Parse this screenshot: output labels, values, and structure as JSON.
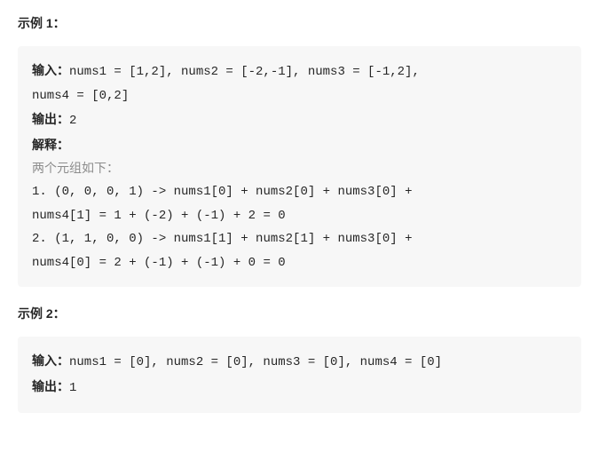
{
  "example1": {
    "heading": "示例 1：",
    "input_label": "输入：",
    "input_line1": "nums1 = [1,2], nums2 = [-2,-1], nums3 = [-1,2],",
    "input_line2": "nums4 = [0,2]",
    "output_label": "输出：",
    "output_value": "2",
    "explain_label": "解释：",
    "tuples_note": "两个元组如下：",
    "calc1_line1": "1. (0, 0, 0, 1) -> nums1[0] + nums2[0] + nums3[0] +",
    "calc1_line2": "nums4[1] = 1 + (-2) + (-1) + 2 = 0",
    "calc2_line1": "2. (1, 1, 0, 0) -> nums1[1] + nums2[1] + nums3[0] +",
    "calc2_line2": "nums4[0] = 2 + (-1) + (-1) + 0 = 0"
  },
  "example2": {
    "heading": "示例 2：",
    "input_label": "输入：",
    "input_value": "nums1 = [0], nums2 = [0], nums3 = [0], nums4 = [0]",
    "output_label": "输出：",
    "output_value": "1"
  }
}
